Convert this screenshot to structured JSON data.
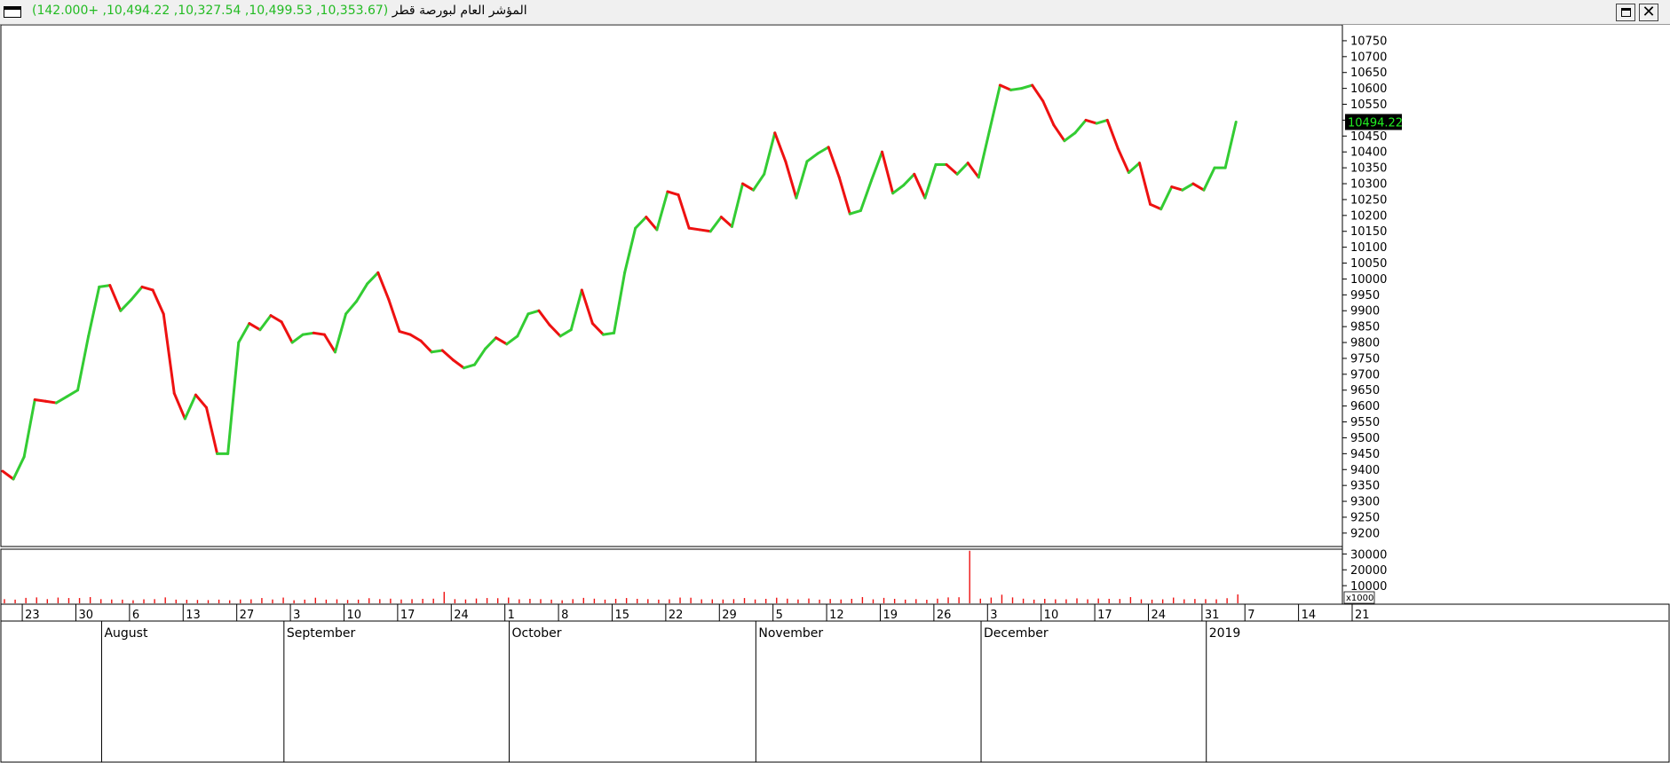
{
  "window": {
    "title": "المؤشر العام لبورصة قطر",
    "ohlc_readout": "(10,353.67, 10,499.53, 10,327.54, 10,494.22, +142.000)"
  },
  "colors": {
    "up": "#33cc33",
    "down": "#ee1111",
    "last_price_bg": "#000000",
    "last_price_text": "#22ee22",
    "volume": "#ee1111"
  },
  "icons": {
    "maximize": "maximize-icon",
    "close": "close-icon",
    "window": "window-icon"
  },
  "chart_data": [
    {
      "type": "line",
      "title": "",
      "x_unit": "trading day",
      "ylim": [
        9170,
        10790
      ],
      "yticks": [
        9200,
        9250,
        9300,
        9350,
        9400,
        9450,
        9500,
        9550,
        9600,
        9650,
        9700,
        9750,
        9800,
        9850,
        9900,
        9950,
        10000,
        10050,
        10100,
        10150,
        10200,
        10250,
        10300,
        10350,
        10400,
        10450,
        10500,
        10550,
        10600,
        10650,
        10700,
        10750
      ],
      "last_price_label": "10494.22",
      "last_price_value": 10494.22,
      "values": [
        9395,
        9370,
        9440,
        9620,
        9615,
        9610,
        9630,
        9650,
        9820,
        9975,
        9980,
        9900,
        9935,
        9975,
        9965,
        9890,
        9640,
        9560,
        9635,
        9595,
        9450,
        9450,
        9800,
        9860,
        9840,
        9885,
        9865,
        9800,
        9825,
        9830,
        9825,
        9770,
        9890,
        9930,
        9985,
        10020,
        9935,
        9835,
        9825,
        9805,
        9770,
        9775,
        9745,
        9720,
        9730,
        9780,
        9815,
        9795,
        9820,
        9890,
        9900,
        9855,
        9820,
        9840,
        9965,
        9860,
        9825,
        9830,
        10020,
        10160,
        10195,
        10155,
        10275,
        10265,
        10160,
        10155,
        10150,
        10195,
        10165,
        10300,
        10280,
        10330,
        10460,
        10370,
        10255,
        10370,
        10395,
        10415,
        10320,
        10205,
        10215,
        10310,
        10400,
        10270,
        10295,
        10330,
        10255,
        10360,
        10360,
        10330,
        10365,
        10320,
        10465,
        10610,
        10595,
        10600,
        10610,
        10560,
        10485,
        10435,
        10460,
        10500,
        10490,
        10500,
        10410,
        10335,
        10365,
        10235,
        10220,
        10290,
        10280,
        10300,
        10280,
        10350,
        10350,
        10494.22
      ]
    },
    {
      "type": "bar",
      "title": "",
      "ylim": [
        0,
        33000
      ],
      "yticks": [
        10000,
        20000,
        30000
      ],
      "unit_label": "x1000",
      "values": [
        1500,
        1200,
        2300,
        2600,
        1500,
        2500,
        2200,
        2200,
        2800,
        1500,
        1300,
        1200,
        800,
        1400,
        1500,
        2600,
        1200,
        1100,
        1000,
        900,
        1200,
        800,
        1300,
        1400,
        2200,
        1300,
        2500,
        800,
        1200,
        2400,
        1200,
        1400,
        1000,
        1200,
        2100,
        1500,
        1800,
        1300,
        1500,
        1700,
        1800,
        6100,
        1500,
        1300,
        1900,
        2200,
        2100,
        2500,
        1400,
        1700,
        1500,
        1200,
        800,
        1500,
        2300,
        1800,
        1200,
        1700,
        2200,
        1700,
        1500,
        1200,
        1400,
        2500,
        2400,
        1400,
        1400,
        1300,
        1500,
        2200,
        1300,
        1700,
        2400,
        1800,
        1300,
        1900,
        1200,
        1600,
        1300,
        1700,
        2800,
        1400,
        2300,
        1700,
        1200,
        1500,
        1100,
        1800,
        2600,
        2700,
        32000,
        1800,
        2500,
        4300,
        2600,
        1800,
        1200,
        1700,
        1400,
        1400,
        2000,
        1400,
        1900,
        1700,
        1600,
        2800,
        1400,
        1200,
        1400,
        2500,
        1400,
        1600,
        1500,
        1400,
        2100,
        4500
      ]
    }
  ],
  "time_axis": {
    "day_ticks": [
      "23",
      "30",
      "6",
      "13",
      "27",
      "3",
      "10",
      "17",
      "24",
      "1",
      "8",
      "15",
      "22",
      "29",
      "5",
      "12",
      "19",
      "26",
      "3",
      "10",
      "17",
      "24",
      "31",
      "7",
      "14",
      "21"
    ],
    "months": [
      "August",
      "September",
      "October",
      "November",
      "December",
      "2019"
    ]
  }
}
